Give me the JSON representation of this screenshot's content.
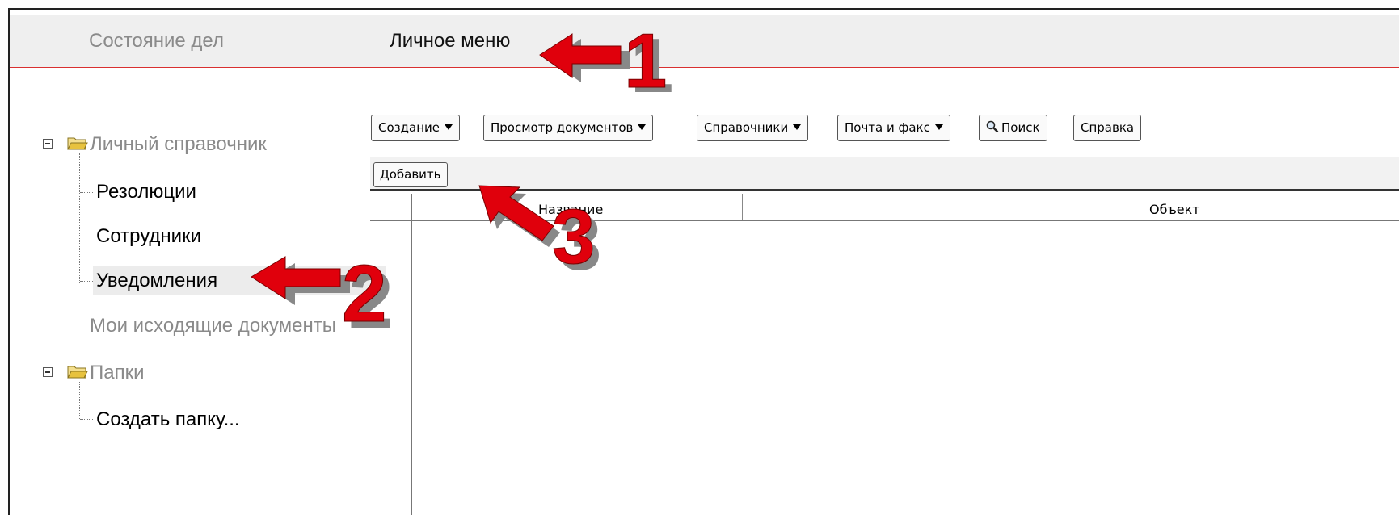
{
  "top_tabs": {
    "status": "Состояние дел",
    "personal_menu": "Личное меню"
  },
  "tree": {
    "personal_directory": {
      "label": "Личный справочник",
      "children": [
        "Резолюции",
        "Сотрудники",
        "Уведомления"
      ]
    },
    "outgoing": "Мои исходящие документы",
    "folders": {
      "label": "Папки",
      "children": [
        "Создать папку..."
      ]
    }
  },
  "toolbar": {
    "create": "Создание",
    "view_documents": "Просмотр документов",
    "directories": "Справочники",
    "mail_fax": "Почта и факс",
    "search": "Поиск",
    "help": "Справка"
  },
  "actions": {
    "add": "Добавить"
  },
  "grid": {
    "columns": [
      "Название",
      "Объект"
    ]
  },
  "annotations": {
    "arrow_1": "1",
    "arrow_2": "2",
    "arrow_3": "3"
  },
  "colors": {
    "arrow_red": "#e0000c",
    "menu_border": "#d93030",
    "selected_row": "#ececec"
  }
}
